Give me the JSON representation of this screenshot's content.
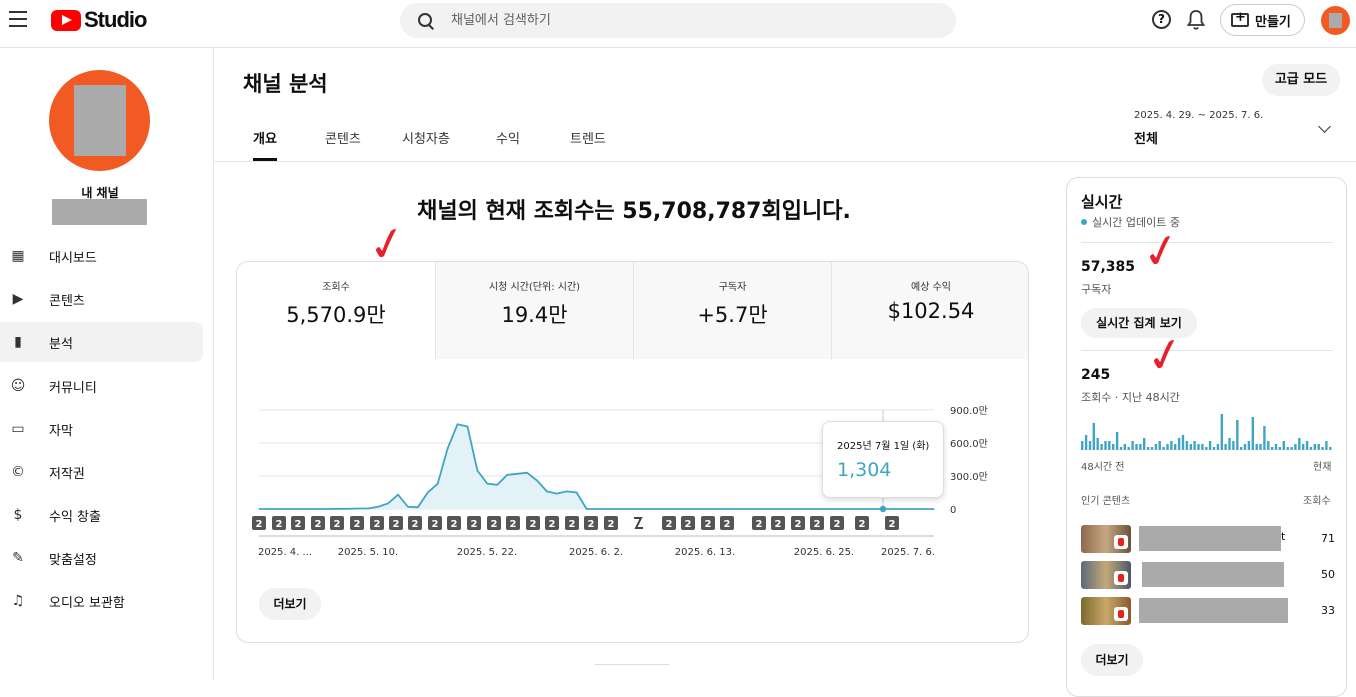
{
  "topbar": {
    "logo_text": "Studio",
    "search_placeholder": "채널에서 검색하기",
    "create_label": "만들기",
    "help_glyph": "?"
  },
  "sidebar": {
    "channel_label": "내 채널",
    "items": [
      {
        "label": "대시보드",
        "icon": "dashboard-icon",
        "glyph": "▦"
      },
      {
        "label": "콘텐츠",
        "icon": "content-icon",
        "glyph": "▶"
      },
      {
        "label": "분석",
        "icon": "analytics-icon",
        "glyph": "▮"
      },
      {
        "label": "커뮤니티",
        "icon": "community-icon",
        "glyph": "☺"
      },
      {
        "label": "자막",
        "icon": "subtitles-icon",
        "glyph": "▭"
      },
      {
        "label": "저작권",
        "icon": "copyright-icon",
        "glyph": "©"
      },
      {
        "label": "수익 창출",
        "icon": "monetization-icon",
        "glyph": "$"
      },
      {
        "label": "맞춤설정",
        "icon": "customization-icon",
        "glyph": "✎"
      },
      {
        "label": "오디오 보관함",
        "icon": "audio-library-icon",
        "glyph": "♫"
      }
    ]
  },
  "header": {
    "title": "채널 분석",
    "advanced_mode": "고급 모드",
    "tabs": [
      "개요",
      "콘텐츠",
      "시청자층",
      "수익",
      "트렌드"
    ],
    "date_range": "2025. 4. 29. ~ 2025. 7. 6.",
    "date_selection": "전체"
  },
  "overview": {
    "headline": "채널의 현재 조회수는 55,708,787회입니다.",
    "metrics": [
      {
        "label": "조회수",
        "value": "5,570.9만"
      },
      {
        "label": "시청 시간(단위: 시간)",
        "value": "19.4만"
      },
      {
        "label": "구독자",
        "value": "+5.7만"
      },
      {
        "label": "예상 수익",
        "value": "$102.54"
      }
    ],
    "more_label": "더보기",
    "tooltip": {
      "date": "2025년 7월 1일 (화)",
      "value": "1,304"
    },
    "marker_glyph": "2"
  },
  "chart_data": {
    "type": "area",
    "y_ticks": [
      "900.0만",
      "600.0만",
      "300.0만",
      "0"
    ],
    "ylim": [
      0,
      9000000
    ],
    "x_tick_labels": [
      "2025. 4. ...",
      "2025. 5. 10.",
      "2025. 5. 22.",
      "2025. 6. 2.",
      "2025. 6. 13.",
      "2025. 6. 25.",
      "2025. 7. 6."
    ],
    "grid": true,
    "series": [
      {
        "values": [
          0,
          0,
          0,
          0,
          0,
          0,
          0,
          0,
          20000,
          20000,
          50000,
          50000,
          200000,
          500000,
          1300000,
          200000,
          150000,
          1500000,
          2300000,
          5500000,
          7700000,
          7500000,
          3500000,
          2300000,
          2200000,
          3100000,
          3200000,
          3300000,
          2600000,
          1600000,
          1400000,
          1600000,
          1500000,
          0,
          0,
          0,
          0,
          0,
          0,
          0,
          0,
          0,
          0,
          0,
          0,
          0,
          0,
          0,
          0,
          0,
          0,
          0,
          0,
          0,
          0,
          0,
          0,
          0,
          0,
          0,
          0,
          0,
          0,
          0,
          0,
          0,
          0,
          0,
          0
        ]
      }
    ]
  },
  "realtime": {
    "title": "실시간",
    "status": "실시간 업데이트 중",
    "subscribers": "57,385",
    "subscribers_label": "구독자",
    "button": "실시간 집계 보기",
    "views": "245",
    "views_label": "조회수 · 지난 48시간",
    "bars_start": "48시간 전",
    "bars_end": "현재",
    "bar_values": [
      3,
      5,
      3,
      9,
      4,
      2,
      3,
      3,
      2,
      6,
      1,
      2,
      1,
      3,
      2,
      2,
      4,
      1,
      1,
      2,
      3,
      1,
      2,
      3,
      2,
      4,
      5,
      3,
      2,
      3,
      2,
      2,
      1,
      3,
      1,
      2,
      12,
      2,
      4,
      3,
      10,
      1,
      2,
      3,
      11,
      2,
      2,
      8,
      3,
      1,
      2,
      1,
      3,
      1,
      1,
      2,
      4,
      2,
      3,
      1,
      2,
      2,
      1,
      3,
      1
    ],
    "bar_color": "#3ea6c4",
    "top_content_label": "인기 콘텐츠",
    "views_col": "조회수",
    "rows": [
      {
        "tail": "t",
        "count": "71"
      },
      {
        "tail": "",
        "count": "50"
      },
      {
        "tail": "",
        "count": "33"
      }
    ],
    "more_label": "더보기"
  },
  "annotation": {
    "check": "✓",
    "color": "#e8202a"
  },
  "colors": {
    "accent": "#3ea6c4",
    "brand": "#ff0000",
    "avatar": "#f25a24"
  }
}
